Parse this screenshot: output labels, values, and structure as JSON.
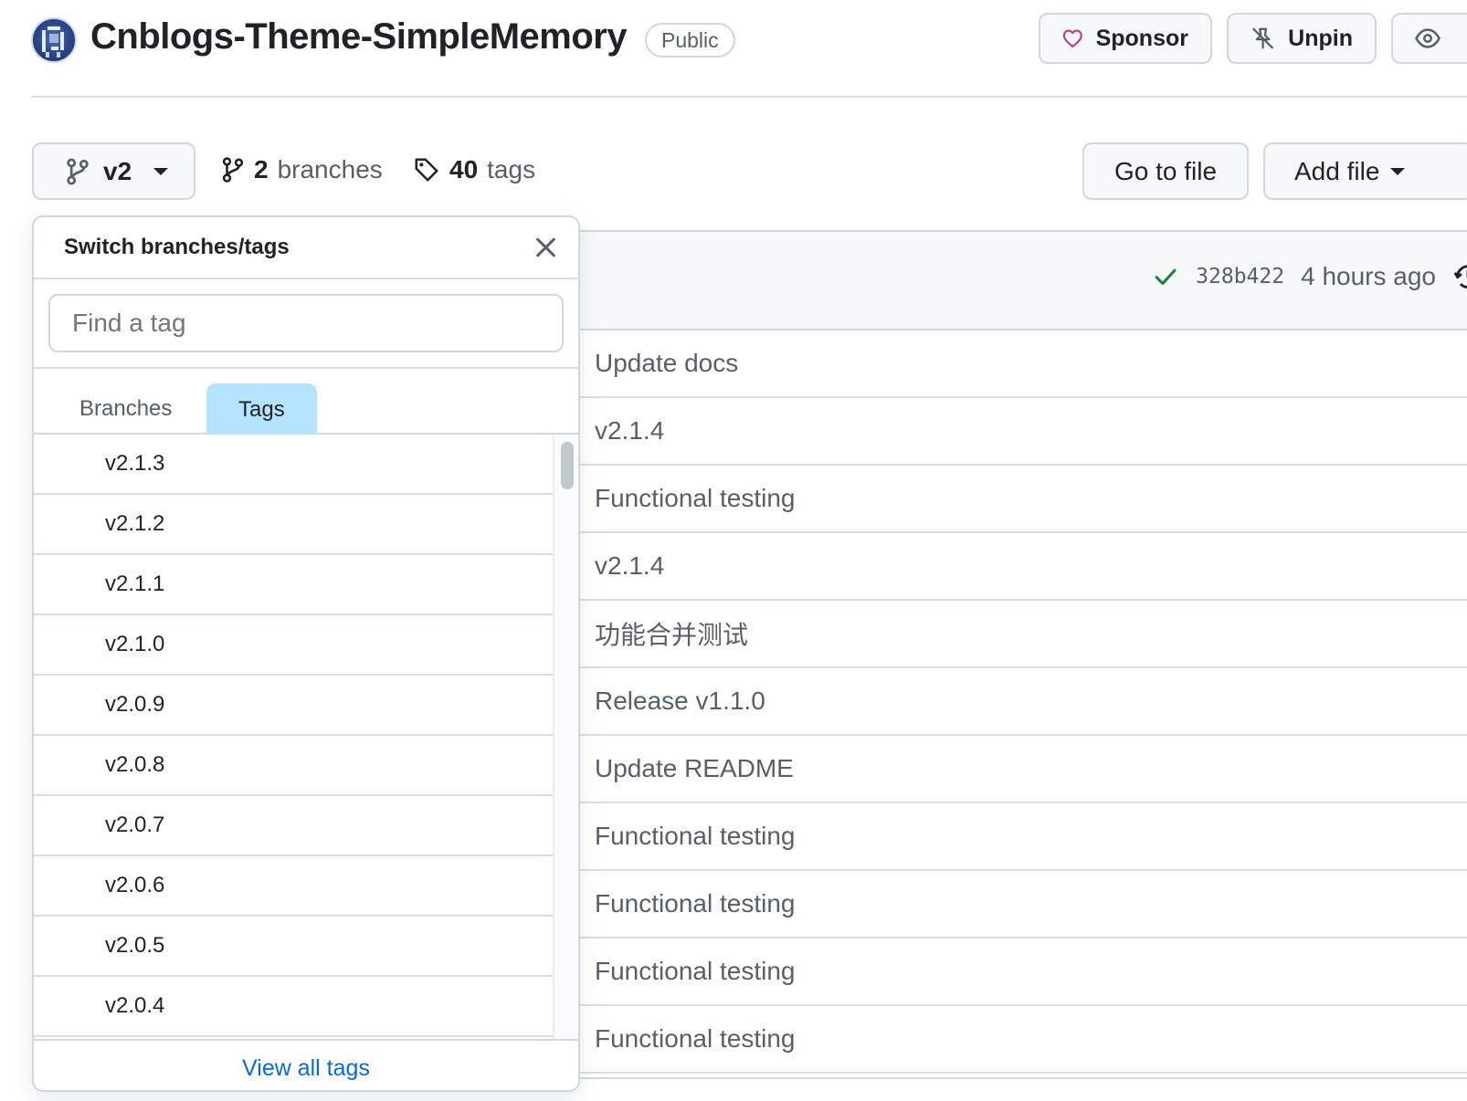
{
  "repo": {
    "name": "Cnblogs-Theme-SimpleMemory",
    "visibility": "Public",
    "actions": {
      "sponsor_label": "Sponsor",
      "unpin_label": "Unpin"
    }
  },
  "toolbar": {
    "current_branch": "v2",
    "branches_count": "2",
    "branches_label": "branches",
    "tags_count": "40",
    "tags_label": "tags",
    "go_to_file_label": "Go to file",
    "add_file_label": "Add file"
  },
  "latest_commit": {
    "hash": "328b422",
    "time": "4 hours ago"
  },
  "file_rows": [
    "Update docs",
    "v2.1.4",
    "Functional testing",
    "v2.1.4",
    "功能合并测试",
    "Release v1.1.0",
    "Update README",
    "Functional testing",
    "Functional testing",
    "Functional testing",
    "Functional testing"
  ],
  "popup": {
    "title": "Switch branches/tags",
    "search_placeholder": "Find a tag",
    "tabs": [
      "Branches",
      "Tags"
    ],
    "active_tab": "Tags",
    "tags": [
      "v2.1.3",
      "v2.1.2",
      "v2.1.1",
      "v2.1.0",
      "v2.0.9",
      "v2.0.8",
      "v2.0.7",
      "v2.0.6",
      "v2.0.5",
      "v2.0.4"
    ],
    "view_all_label": "View all tags"
  },
  "colors": {
    "accent": "#0969da",
    "active_tab": "#b6e3ff",
    "success": "#1a7f37",
    "sponsor": "#bf3989"
  }
}
